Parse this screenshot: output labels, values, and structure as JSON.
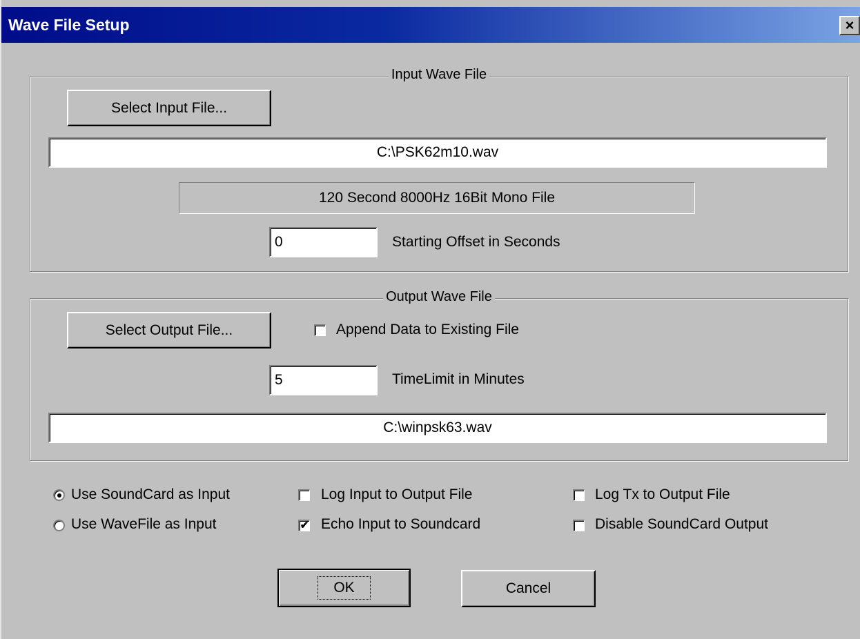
{
  "window": {
    "title": "Wave File Setup",
    "close_glyph": "×",
    "close_icon": "close-icon"
  },
  "input_group": {
    "legend": "Input Wave File",
    "select_button": "Select Input File...",
    "file_path": "C:\\PSK62m10.wav",
    "file_info": "120 Second 8000Hz 16Bit Mono File",
    "offset_value": "0",
    "offset_label": "Starting Offset in Seconds"
  },
  "output_group": {
    "legend": "Output Wave File",
    "select_button": "Select Output File...",
    "append_label": "Append Data to Existing File",
    "append_checked": false,
    "timelimit_value": "5",
    "timelimit_label": "TimeLimit in Minutes",
    "file_path": "C:\\winpsk63.wav"
  },
  "options": {
    "use_soundcard": {
      "label": "Use SoundCard as Input",
      "selected": true
    },
    "use_wavefile": {
      "label": "Use WaveFile as Input",
      "selected": false
    },
    "log_input": {
      "label": "Log Input to Output File",
      "checked": false
    },
    "echo_input": {
      "label": "Echo Input to Soundcard",
      "checked": true
    },
    "log_tx": {
      "label": "Log Tx to Output File",
      "checked": false
    },
    "disable_output": {
      "label": "Disable SoundCard Output",
      "checked": false
    }
  },
  "buttons": {
    "ok": "OK",
    "cancel": "Cancel"
  },
  "colors": {
    "dialog_bg": "#c0c0c0",
    "title_start": "#000c8a",
    "title_end": "#7aa4e4",
    "title_text": "#ffffff"
  }
}
